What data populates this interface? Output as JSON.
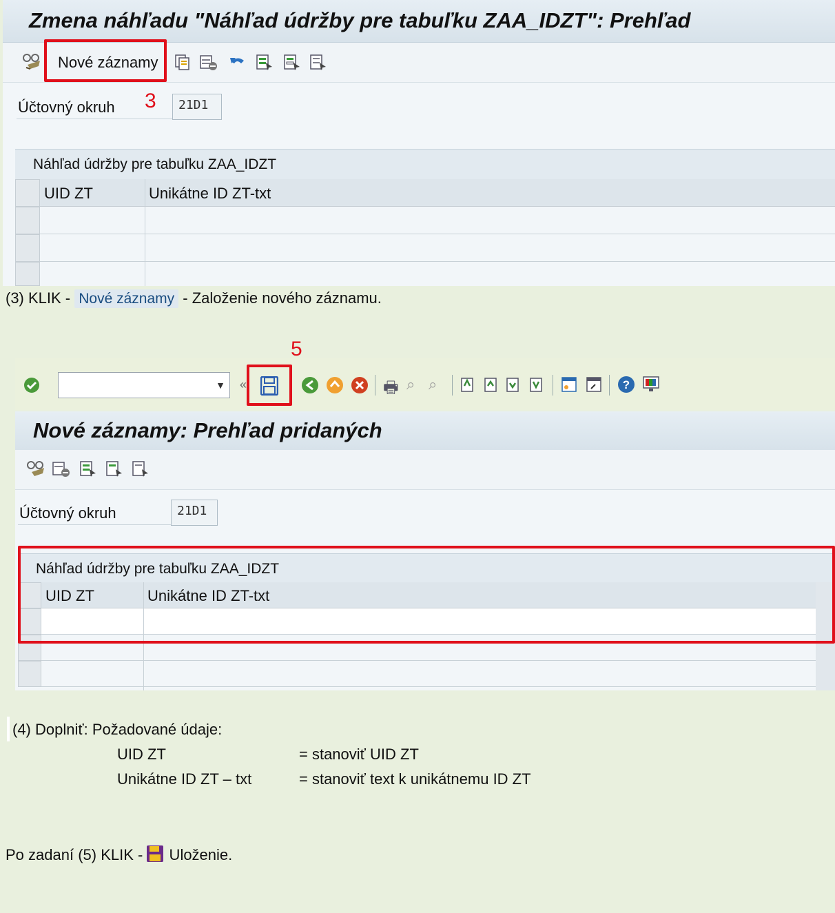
{
  "screen1": {
    "title": "Zmena náhľadu \"Náhľad údržby pre tabuľku ZAA_IDZT\": Prehľad",
    "toolbar": {
      "new_entries_label": "Nové záznamy",
      "icons": [
        "display-change-icon",
        "copy-icon",
        "delete-icon",
        "undo-icon",
        "select-all-icon",
        "select-block-icon",
        "deselect-all-icon"
      ]
    },
    "step_marker": "3",
    "field": {
      "label": "Účtovný okruh",
      "value": "21D1"
    },
    "table": {
      "title": "Náhľad údržby pre tabuľku ZAA_IDZT",
      "columns": [
        "UID ZT",
        "Unikátne ID ZT-txt"
      ]
    }
  },
  "instruction3": {
    "prefix": "(3) KLIK - ",
    "button": "Nové záznamy",
    "suffix": " - Založenie nového záznamu."
  },
  "screen2": {
    "step_marker": "5",
    "command_field": {
      "value": ""
    },
    "title": "Nové záznamy: Prehľad pridaných",
    "field": {
      "label": "Účtovný okruh",
      "value": "21D1"
    },
    "table": {
      "title": "Náhľad údržby pre tabuľku ZAA_IDZT",
      "columns": [
        "UID ZT",
        "Unikátne ID ZT-txt"
      ]
    }
  },
  "instruction4": {
    "line1": "(4)  Doplniť: Požadované údaje:",
    "row1_label": "UID ZT",
    "row1_value": "= stanoviť UID ZT",
    "row2_label": "Unikátne ID ZT – txt",
    "row2_value": "= stanoviť text k unikátnemu ID ZT"
  },
  "instruction5": {
    "prefix": "Po zadaní (5) KLIK - ",
    "suffix": " Uloženie."
  },
  "colors": {
    "accent_red": "#e0101b",
    "background_green": "#e9f0de",
    "sap_panel": "#f2f6f9"
  }
}
